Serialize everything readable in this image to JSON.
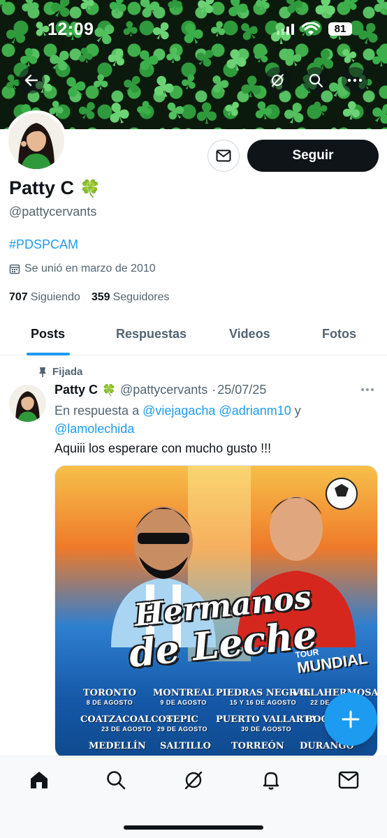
{
  "status_bar": {
    "time": "12:09",
    "battery": "81"
  },
  "profile": {
    "name": "Patty C",
    "name_emoji": "🍀",
    "handle": "@pattycervants",
    "hashtag": "#PDSPCAM",
    "joined": "Se unió en marzo de 2010",
    "following_count": "707",
    "following_label": "Siguiendo",
    "followers_count": "359",
    "followers_label": "Seguidores",
    "follow_button": "Seguir"
  },
  "tabs": [
    {
      "label": "Posts",
      "active": true
    },
    {
      "label": "Respuestas",
      "active": false
    },
    {
      "label": "Videos",
      "active": false
    },
    {
      "label": "Fotos",
      "active": false
    }
  ],
  "post": {
    "pinned_label": "Fijada",
    "author_name": "Patty C",
    "author_emoji": "🍀",
    "author_handle": "@pattycervants",
    "separator": "·",
    "date": "25/07/25",
    "reply_prefix": "En respuesta a",
    "mentions": [
      "@viejagacha",
      "@adrianm10",
      "@lamolechida"
    ],
    "reply_conjunction": "y",
    "text": "Aquiii los esperare con mucho gusto !!!",
    "media": {
      "title_line1": "Hermanos",
      "title_line2": "de Leche",
      "tour_line1": "TOUR",
      "tour_line2": "MUNDIAL",
      "cities": [
        {
          "name": "TORONTO",
          "date": "8 DE AGOSTO"
        },
        {
          "name": "MONTREAL",
          "date": "9 DE AGOSTO"
        },
        {
          "name": "PIEDRAS NEGRAS",
          "date": "15 Y 16 DE AGOSTO"
        },
        {
          "name": "VILLAHERMOSA",
          "date": "22 DE AGOSTO"
        },
        {
          "name": "COATZACOALCOS",
          "date": "23 DE AGOSTO"
        },
        {
          "name": "TEPIC",
          "date": "29 DE AGOSTO"
        },
        {
          "name": "PUERTO VALLARTA",
          "date": "30 DE AGOSTO"
        },
        {
          "name": "BOGOTÁ",
          "date": ""
        },
        {
          "name": "MEDELLÍN",
          "date": ""
        },
        {
          "name": "SALTILLO",
          "date": ""
        },
        {
          "name": "TORREÓN",
          "date": ""
        },
        {
          "name": "DURANGO",
          "date": ""
        }
      ]
    }
  },
  "colors": {
    "accent": "#1d9bf0",
    "banner_green": "#3bb04a",
    "text_primary": "#0f1419",
    "text_secondary": "#536471"
  },
  "icons": [
    "back-arrow-icon",
    "grok-icon",
    "search-icon",
    "more-icon",
    "mail-icon",
    "calendar-icon",
    "pin-icon",
    "plus-icon",
    "home-icon",
    "search-icon",
    "grok-icon",
    "bell-icon",
    "mail-icon"
  ]
}
